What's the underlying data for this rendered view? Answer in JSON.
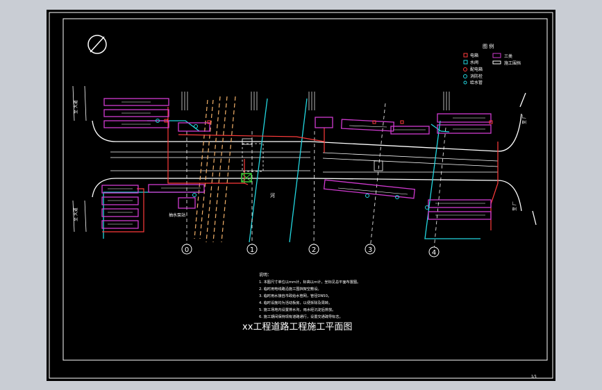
{
  "drawing": {
    "title": "xx工程道路工程施工平面图",
    "page_no": "1/1",
    "river_label": "河",
    "left_road_top": "至 大道",
    "left_road_bottom": "至 大道",
    "right_road_label": "至 厂",
    "right_road_label2": "至 厂",
    "pump_label": "抽水泵站",
    "axis_labels": [
      "0",
      "1",
      "2",
      "3",
      "4"
    ],
    "legend": {
      "title": "图 例",
      "items": [
        {
          "label": "电箱",
          "color": "#ff3b3b"
        },
        {
          "label": "水阀",
          "color": "#23d7e0"
        },
        {
          "label": "配电箱",
          "color": "#ff3b3b"
        },
        {
          "label": "消防栓",
          "color": "#23d7e0"
        },
        {
          "label": "给水管",
          "color": "#23d7e0"
        },
        {
          "label": "三类",
          "color": "#d03ad0"
        },
        {
          "label": "施工围挡",
          "color": "#ffffff"
        }
      ]
    },
    "notes": {
      "heading": "说明：",
      "lines": [
        "1. 本图尺寸单位以mm计，标高以m计，坐标见总平面布置图。",
        "2. 临时用电线路沿施工围挡架空敷设。",
        "3. 临时用水接自市政给水管网，管径DN50。",
        "4. 临时设施均为活动板房，以便拆除及周转。",
        "5. 施工场地内设置排水沟，雨水经沉淀后排放。",
        "6. 施工期间保持现有道路通行，设置交通疏导标志。"
      ]
    },
    "colors": {
      "background": "#000000",
      "frame": "#ffffff",
      "power": "#ff3b3b",
      "water": "#23d7e0",
      "facility": "#d03ad0",
      "fence": "#ffffff",
      "grid": "#f4b26a"
    }
  }
}
